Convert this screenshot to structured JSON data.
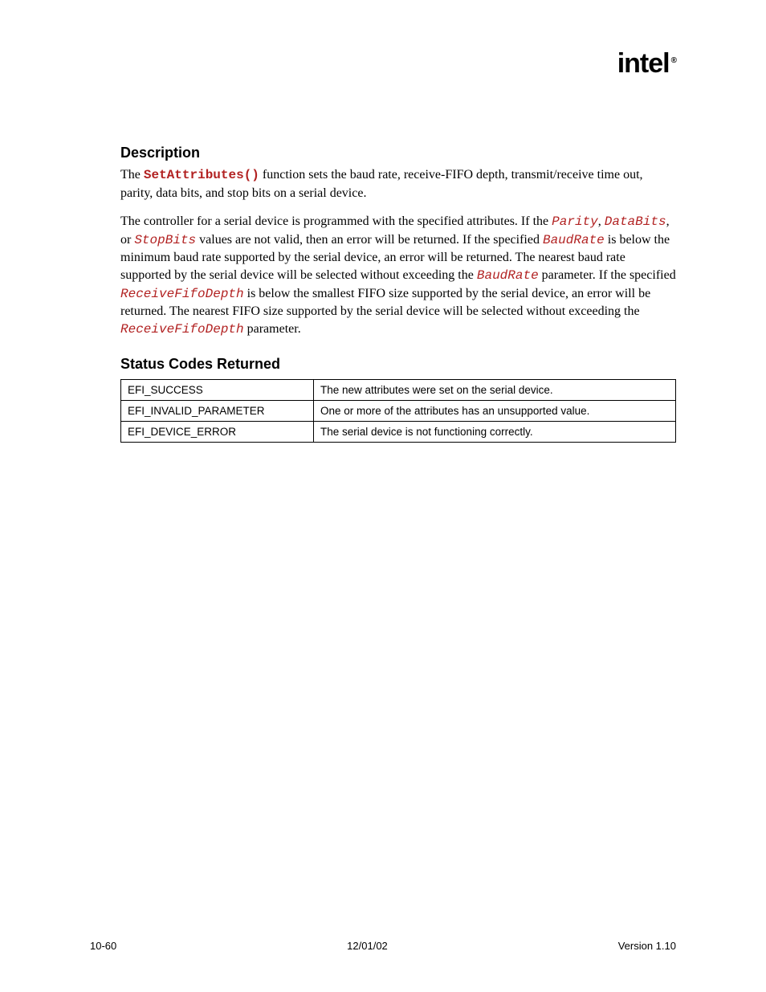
{
  "logo": {
    "text": "intel",
    "sub": "®"
  },
  "section1": {
    "heading": "Description",
    "para1_a": "The ",
    "para1_code": "SetAttributes()",
    "para1_b": " function sets the baud rate, receive-FIFO depth, transmit/receive time out, parity, data bits, and stop bits on a serial device.",
    "para2_a": "The controller for a serial device is programmed with the specified attributes.  If the ",
    "para2_parity": "Parity",
    "para2_b": ", ",
    "para2_databits": "DataBits",
    "para2_c": ", or ",
    "para2_stopbits": "StopBits",
    "para2_d": " values are not valid, then an error will be returned.  If the specified ",
    "para2_baud1": "BaudRate",
    "para2_e": " is below the minimum baud rate supported by the serial device, an error will be returned.  The nearest baud rate supported by the serial device will be selected without exceeding the ",
    "para2_baud2": "BaudRate",
    "para2_f": " parameter.  If the specified ",
    "para2_rfd1": "ReceiveFifoDepth",
    "para2_g": " is below the smallest FIFO size supported by the serial device, an error will be returned.  The nearest FIFO size supported by the serial device will be selected without exceeding the ",
    "para2_rfd2": "ReceiveFifoDepth",
    "para2_h": " parameter."
  },
  "section2": {
    "heading": "Status Codes Returned",
    "rows": [
      {
        "code": "EFI_SUCCESS",
        "desc": "The new attributes were set on the serial device."
      },
      {
        "code": "EFI_INVALID_PARAMETER",
        "desc": "One or more of the attributes has an unsupported value."
      },
      {
        "code": "EFI_DEVICE_ERROR",
        "desc": "The serial device is not functioning correctly."
      }
    ]
  },
  "footer": {
    "left": "10-60",
    "center": "12/01/02",
    "right": "Version 1.10"
  }
}
